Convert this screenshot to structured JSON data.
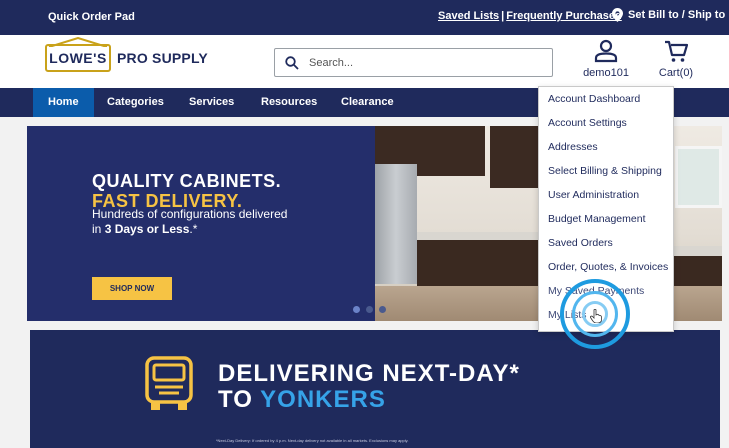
{
  "topbar": {
    "quick_order": "Quick Order Pad",
    "saved_lists": "Saved Lists",
    "separator": "|",
    "frequently_purchased": "Frequently Purchased",
    "bill_ship": "Set Bill to / Ship to"
  },
  "header": {
    "logo_mark": "LOWE'S",
    "logo_text": "PRO SUPPLY",
    "search_placeholder": "Search...",
    "account_label": "demo101",
    "cart_label": "Cart(0)"
  },
  "nav": {
    "items": [
      "Home",
      "Categories",
      "Services",
      "Resources",
      "Clearance"
    ]
  },
  "hero": {
    "headline_1": "QUALITY CABINETS.",
    "headline_2": "FAST DELIVERY.",
    "sub_1": "Hundreds of configurations delivered in ",
    "sub_bold": "3 Days or Less",
    "sub_2": ".*",
    "cta": "SHOP NOW"
  },
  "banner2": {
    "line1": "DELIVERING NEXT-DAY*",
    "line2_a": "TO ",
    "line2_b": "YONKERS",
    "fine_print": "*Next-Day Delivery: If ordered by 4 p.m. Next-day delivery not available in all markets. Exclusions may apply."
  },
  "account_menu": {
    "items": [
      "Account Dashboard",
      "Account Settings",
      "Addresses",
      "Select Billing & Shipping",
      "User Administration",
      "Budget Management",
      "Saved Orders",
      "Order, Quotes, & Invoices",
      "My Saved Payments",
      "My Lists"
    ]
  },
  "colors": {
    "navy": "#1f2a5c",
    "accent_blue": "#0b5cab",
    "yellow": "#f6c344",
    "light_blue": "#36a3e8"
  }
}
